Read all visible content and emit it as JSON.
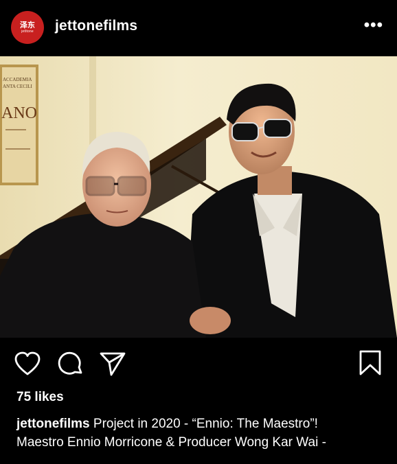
{
  "post": {
    "avatar_text_cn": "泽东",
    "avatar_text_en": "jetltone",
    "username": "jettonefilms",
    "more_label": "•••",
    "poster_text": [
      "ACCADEMIA",
      "ANTA CECILI",
      "ANO"
    ],
    "likes": "75 likes",
    "caption_user": "jettonefilms",
    "caption_line1": "Project in 2020 - “Ennio: The Maestro”!",
    "caption_line2": "Maestro Ennio Morricone & Producer Wong Kar Wai -"
  },
  "icons": {
    "like": "heart-icon",
    "comment": "comment-icon",
    "share": "send-icon",
    "save": "bookmark-icon",
    "more": "more-icon"
  },
  "colors": {
    "background": "#000000",
    "avatar": "#c8201f",
    "text": "#ffffff"
  }
}
